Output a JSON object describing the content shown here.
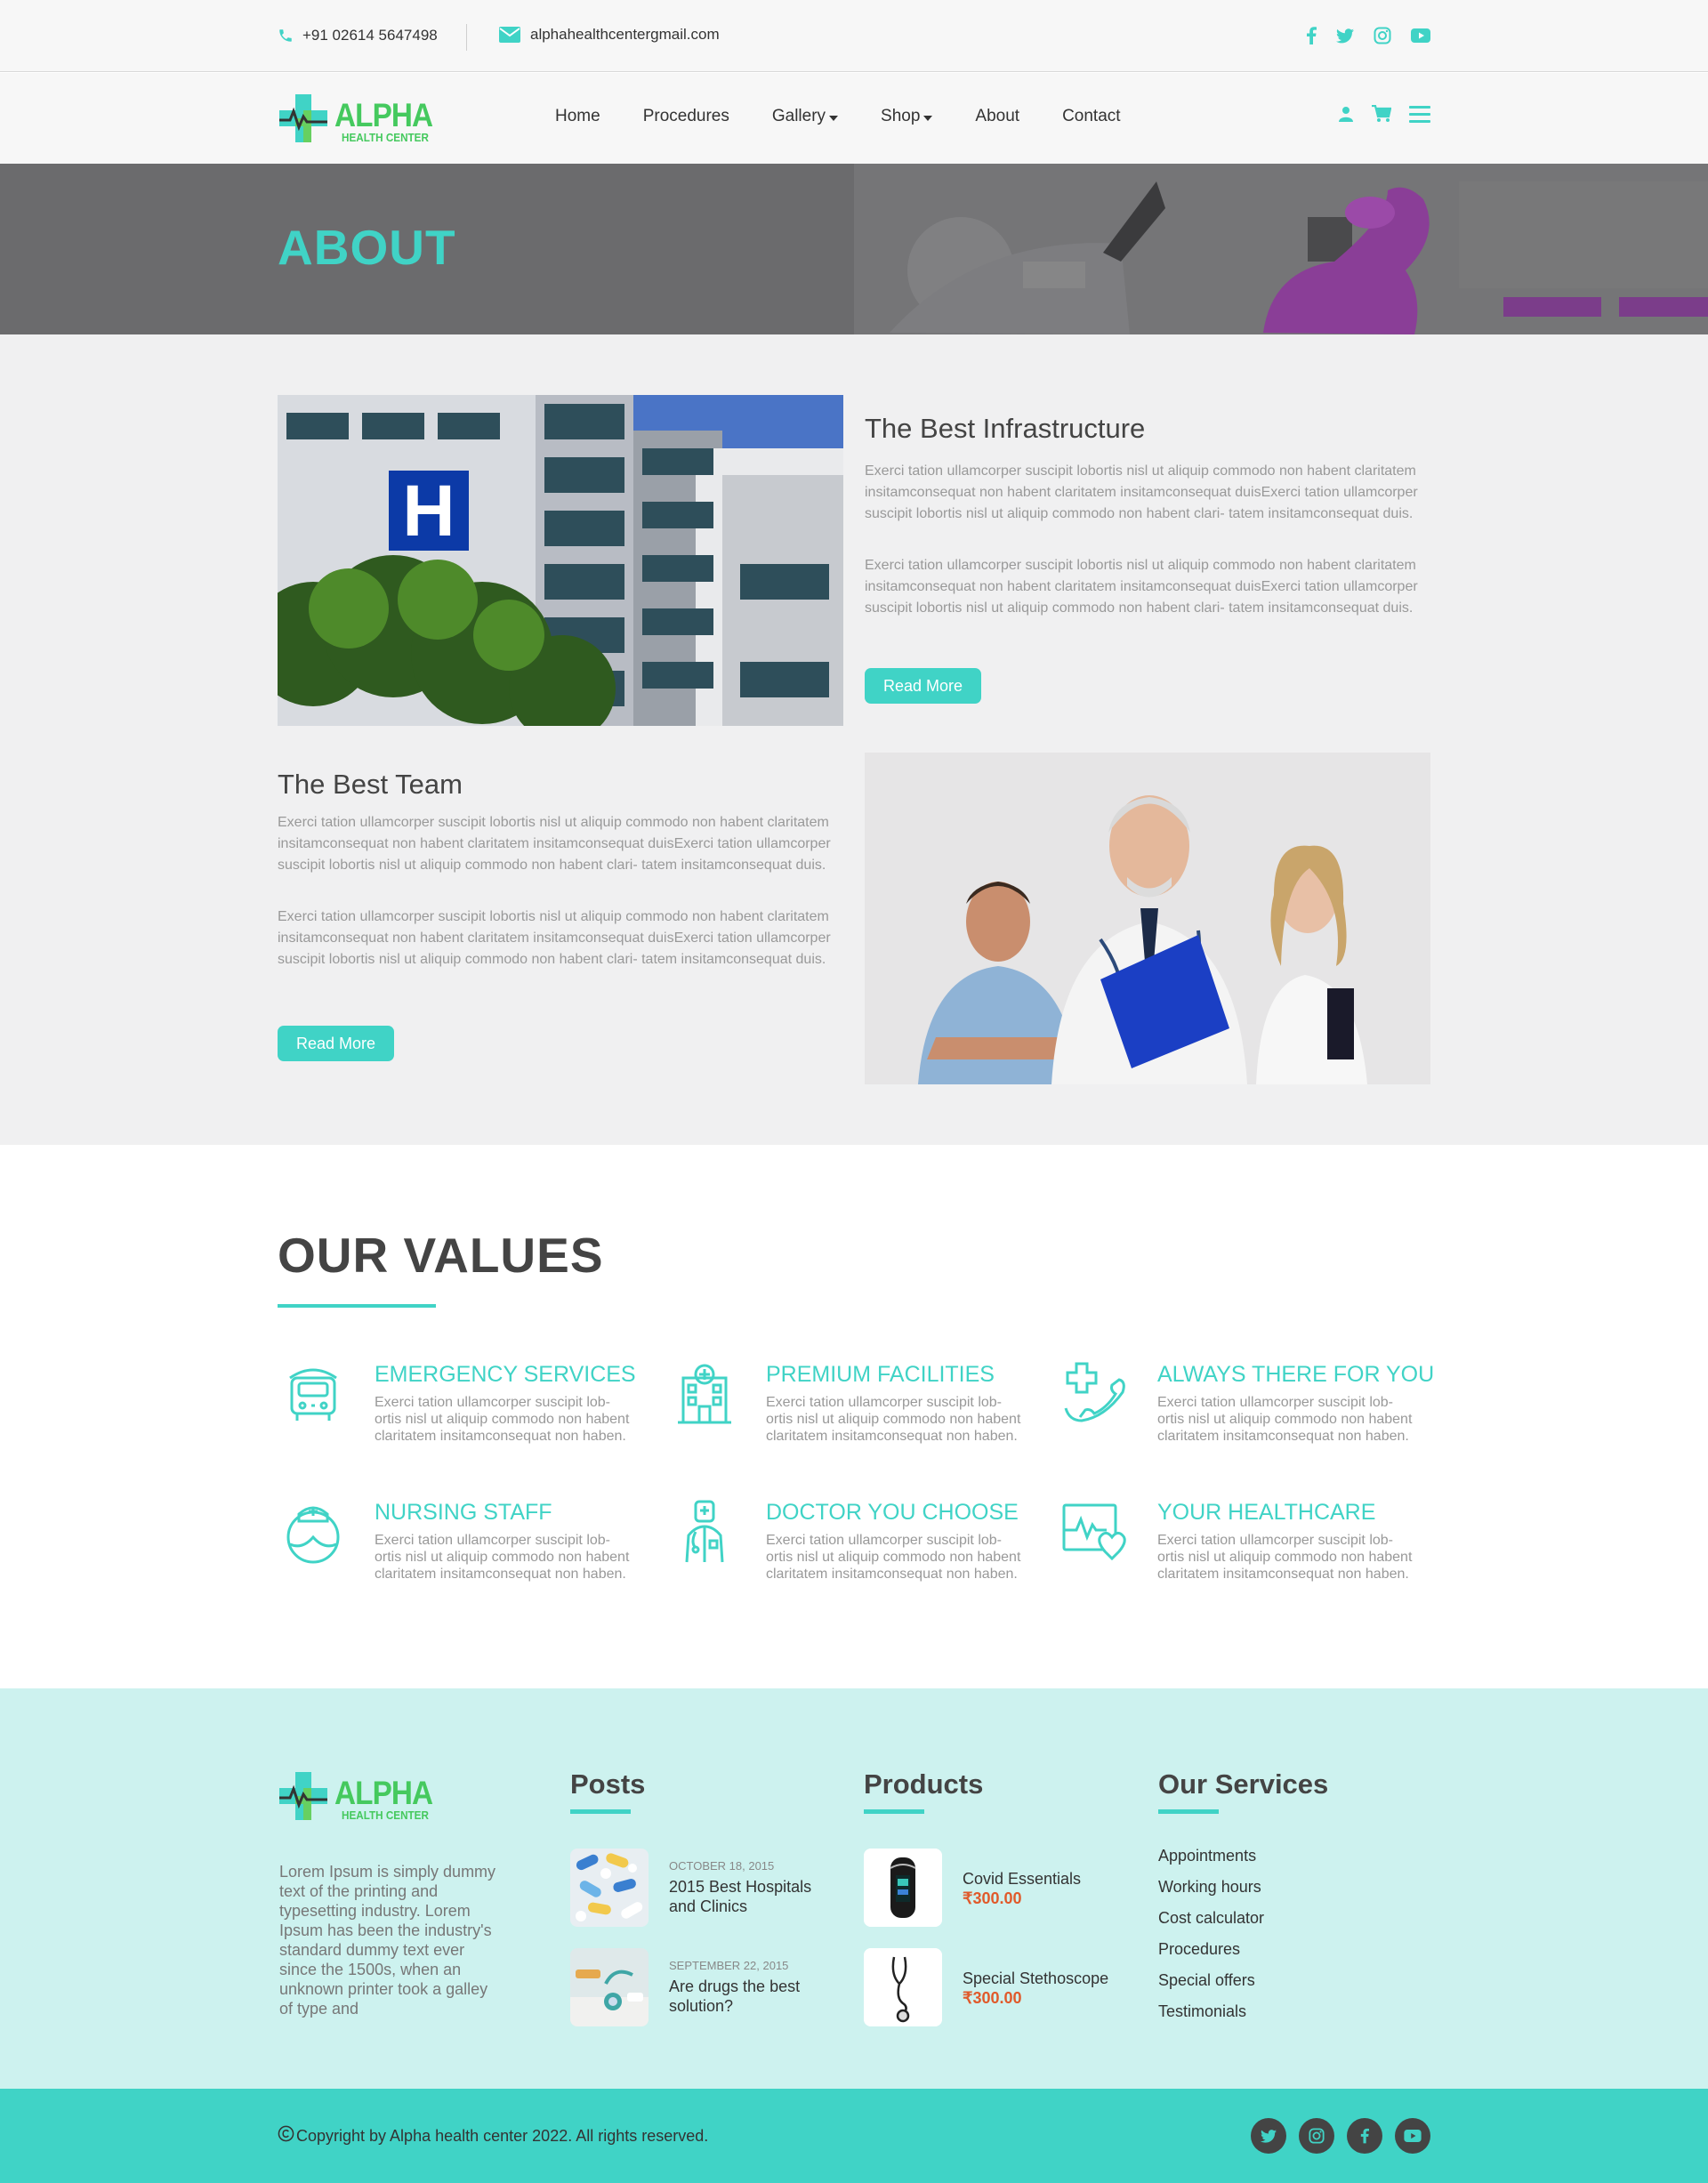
{
  "topbar": {
    "phone": "+91 02614 5647498",
    "email": "alphahealthcentergmail.com",
    "socials": [
      "facebook-icon",
      "twitter-icon",
      "instagram-icon",
      "youtube-icon"
    ]
  },
  "brand": {
    "name": "ALPHA",
    "tagline": "HEALTH CENTER"
  },
  "nav": {
    "items": [
      {
        "label": "Home",
        "dropdown": false
      },
      {
        "label": "Procedures",
        "dropdown": false
      },
      {
        "label": "Gallery",
        "dropdown": true
      },
      {
        "label": "Shop",
        "dropdown": true
      },
      {
        "label": "About",
        "dropdown": false
      },
      {
        "label": "Contact",
        "dropdown": false
      }
    ],
    "icons": [
      "user-icon",
      "cart-icon",
      "menu-icon"
    ]
  },
  "banner": {
    "title": "ABOUT"
  },
  "about": {
    "infrastructure": {
      "title": "The Best Infrastructure",
      "para1": "Exerci tation ullamcorper suscipit lobortis nisl ut aliquip commodo non habent claritatem insitamconsequat non habent claritatem insitamconsequat duisExerci tation ullamcorper suscipit lobortis nisl ut aliquip commodo non habent clari- tatem insitamconsequat duis.",
      "para2": "Exerci tation ullamcorper suscipit lobortis nisl ut aliquip commodo non habent claritatem insitamconsequat non habent claritatem insitamconsequat duisExerci tation ullamcorper suscipit lobortis nisl ut aliquip commodo non habent clari- tatem insitamconsequat duis.",
      "button": "Read More"
    },
    "team": {
      "title": "The Best Team",
      "para1": "Exerci tation ullamcorper suscipit lobortis nisl ut aliquip commodo non habent claritatem insitamconsequat non habent claritatem insitamconsequat duisExerci tation ullamcorper suscipit lobortis nisl ut aliquip commodo non habent clari- tatem insitamconsequat duis.",
      "para2": "Exerci tation ullamcorper suscipit lobortis nisl ut aliquip commodo non habent claritatem insitamconsequat non habent claritatem insitamconsequat duisExerci tation ullamcorper suscipit lobortis nisl ut aliquip commodo non habent clari- tatem insitamconsequat duis.",
      "button": "Read More"
    }
  },
  "values": {
    "title": "OUR VALUES",
    "items": [
      {
        "title": "EMERGENCY SERVICES",
        "text": "Exerci tation ullamcorper suscipit lob- ortis nisl ut aliquip commodo non habent claritatem insitamconsequat non haben.",
        "icon": "ambulance-icon"
      },
      {
        "title": "PREMIUM FACILITIES",
        "text": "Exerci tation ullamcorper suscipit lob- ortis nisl ut aliquip commodo non habent claritatem insitamconsequat non haben.",
        "icon": "hospital-building-icon"
      },
      {
        "title": "ALWAYS THERE FOR YOU",
        "text": "Exerci tation ullamcorper suscipit lob- ortis nisl ut aliquip commodo non habent claritatem insitamconsequat non haben.",
        "icon": "medical-phone-icon"
      },
      {
        "title": "NURSING STAFF",
        "text": "Exerci tation ullamcorper suscipit lob- ortis nisl ut aliquip commodo non habent claritatem insitamconsequat non haben.",
        "icon": "nurse-icon"
      },
      {
        "title": "DOCTOR YOU CHOOSE",
        "text": "Exerci tation ullamcorper suscipit lob- ortis nisl ut aliquip commodo non habent claritatem insitamconsequat non haben.",
        "icon": "doctor-icon"
      },
      {
        "title": "YOUR HEALTHCARE",
        "text": "Exerci tation ullamcorper suscipit lob- ortis nisl ut aliquip commodo non habent claritatem insitamconsequat non haben.",
        "icon": "heart-monitor-icon"
      }
    ]
  },
  "footer": {
    "about_text": "Lorem Ipsum is simply dummy text of the printing and typesetting industry. Lorem Ipsum has been the industry's standard dummy text ever since the 1500s, when an unknown printer took a galley of type and",
    "posts_title": "Posts",
    "posts": [
      {
        "date": "OCTOBER 18, 2015",
        "title": "2015 Best Hospitals and Clinics"
      },
      {
        "date": "SEPTEMBER 22, 2015",
        "title": "Are drugs the best solution?"
      }
    ],
    "products_title": "Products",
    "products": [
      {
        "name": "Covid Essentials",
        "price": "₹300.00"
      },
      {
        "name": "Special Stethoscope",
        "price": "₹300.00"
      }
    ],
    "services_title": "Our Services",
    "services": [
      "Appointments",
      "Working hours",
      "Cost calculator",
      "Procedures",
      "Special offers",
      "Testimonials"
    ],
    "copyright": "Copyright by Alpha health center 2022. All rights reserved.",
    "socials": [
      "twitter-icon",
      "instagram-icon",
      "facebook-icon",
      "youtube-icon"
    ]
  },
  "colors": {
    "accent": "#40d3c6",
    "brand_green": "#45c95e",
    "price": "#e05a2b",
    "footer_bg": "#cdf2ef"
  }
}
